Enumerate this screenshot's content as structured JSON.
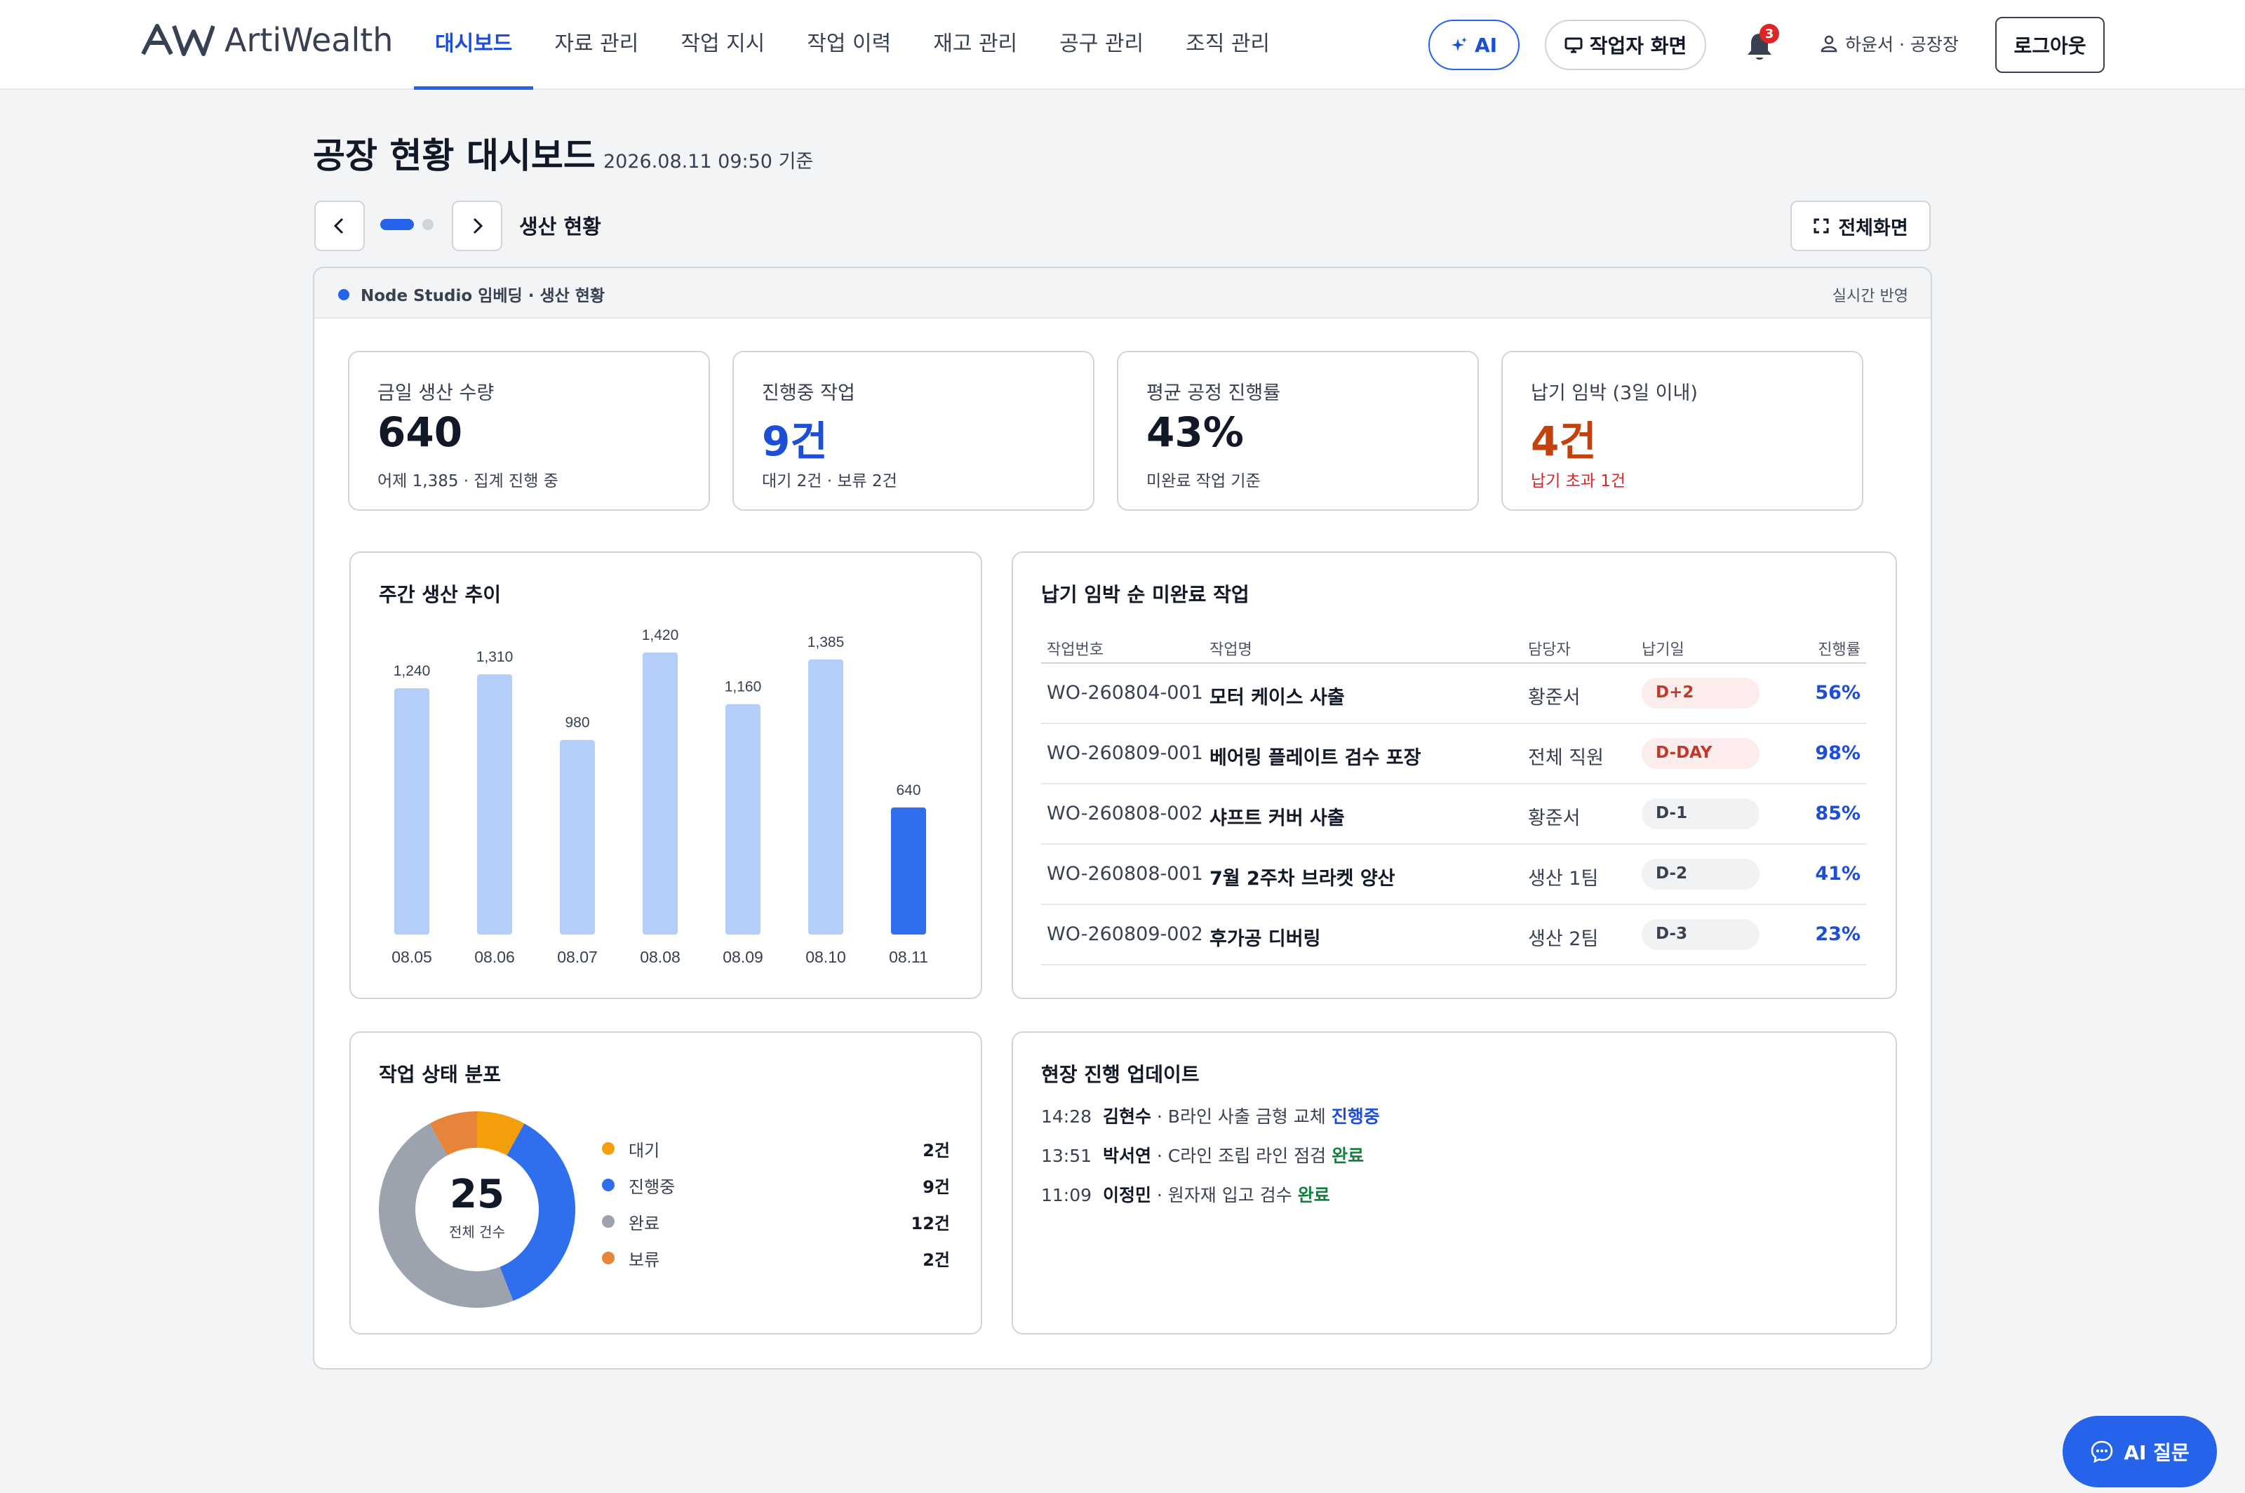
{
  "header": {
    "logo_mark": "AW",
    "logo_text": "ArtiWealth",
    "nav": [
      "대시보드",
      "자료 관리",
      "작업 지시",
      "작업 이력",
      "재고 관리",
      "공구 관리",
      "조직 관리"
    ],
    "ai_label": "AI",
    "worker_label": "작업자 화면",
    "notification_count": "3",
    "user_label": "하윤서 · 공장장",
    "logout_label": "로그아웃"
  },
  "page": {
    "title": "공장 현황 대시보드",
    "timestamp": "2026.08.11 09:50 기준",
    "slide_label": "생산 현황",
    "fullscreen_label": "전체화면",
    "slides_total": 2,
    "slide_active": 1
  },
  "frame": {
    "label": "Node Studio 임베딩 · 생산 현황",
    "status": "실시간 반영"
  },
  "kpis": [
    {
      "label": "금일 생산 수량",
      "value": "640",
      "sub": "어제 1,385 · 집계 진행 중",
      "value_color": "#111827",
      "sub_color": "#374151"
    },
    {
      "label": "진행중 작업",
      "value": "9건",
      "sub": "대기 2건 · 보류 2건",
      "value_color": "#1d4ed8",
      "sub_color": "#374151"
    },
    {
      "label": "평균 공정 진행률",
      "value": "43%",
      "sub": "미완료 작업 기준",
      "value_color": "#111827",
      "sub_color": "#374151"
    },
    {
      "label": "납기 임박 (3일 이내)",
      "value": "4건",
      "sub": "납기 초과 1건",
      "value_color": "#c2410c",
      "sub_color": "#dc2626"
    }
  ],
  "weekly": {
    "title": "주간 생산 추이"
  },
  "chart_data": {
    "type": "bar",
    "title": "주간 생산 추이",
    "categories": [
      "08.05",
      "08.06",
      "08.07",
      "08.08",
      "08.09",
      "08.10",
      "08.11"
    ],
    "values": [
      1240,
      1310,
      980,
      1420,
      1160,
      1385,
      640
    ],
    "value_labels": [
      "1,240",
      "1,310",
      "980",
      "1,420",
      "1,160",
      "1,385",
      "640"
    ],
    "highlight_index": 6,
    "colors": {
      "normal": "#b3cff9",
      "highlight": "#2f6fed"
    }
  },
  "due_table": {
    "title": "납기 임박 순 미완료 작업",
    "columns": [
      "작업번호",
      "작업명",
      "담당자",
      "납기일",
      "진행률"
    ],
    "rows": [
      {
        "id": "WO-260804-001",
        "name": "모터 케이스 사출",
        "owner": "황준서",
        "due": "D+2",
        "progress": "56%",
        "urgent": true
      },
      {
        "id": "WO-260809-001",
        "name": "베어링 플레이트 검수 포장",
        "owner": "전체 직원",
        "due": "D-DAY",
        "progress": "98%",
        "urgent": true
      },
      {
        "id": "WO-260808-002",
        "name": "샤프트 커버 사출",
        "owner": "황준서",
        "due": "D-1",
        "progress": "85%",
        "urgent": false
      },
      {
        "id": "WO-260808-001",
        "name": "7월 2주차 브라켓 양산",
        "owner": "생산 1팀",
        "due": "D-2",
        "progress": "41%",
        "urgent": false
      },
      {
        "id": "WO-260809-002",
        "name": "후가공 디버링",
        "owner": "생산 2팀",
        "due": "D-3",
        "progress": "23%",
        "urgent": false
      }
    ]
  },
  "status_dist": {
    "title": "작업 상태 분포",
    "total": "25",
    "total_label": "전체 건수",
    "items": [
      {
        "name": "대기",
        "value": 2,
        "label": "2건",
        "color": "#f59e0b"
      },
      {
        "name": "진행중",
        "value": 9,
        "label": "9건",
        "color": "#2f6fed"
      },
      {
        "name": "완료",
        "value": 12,
        "label": "12건",
        "color": "#9ca3af"
      },
      {
        "name": "보류",
        "value": 2,
        "label": "2건",
        "color": "#e8833a"
      }
    ]
  },
  "updates": {
    "title": "현장 진행 업데이트",
    "items": [
      {
        "time": "14:28",
        "person": "김현수",
        "text": " · B라인 사출 금형 교체 ",
        "status": "진행중",
        "status_color": "#1d4ed8"
      },
      {
        "time": "13:51",
        "person": "박서연",
        "text": " · C라인 조립 라인 점검 ",
        "status": "완료",
        "status_color": "#15803d"
      },
      {
        "time": "11:09",
        "person": "이정민",
        "text": " · 원자재 입고 검수 ",
        "status": "완료",
        "status_color": "#15803d"
      }
    ]
  },
  "fab_label": "AI 질문"
}
